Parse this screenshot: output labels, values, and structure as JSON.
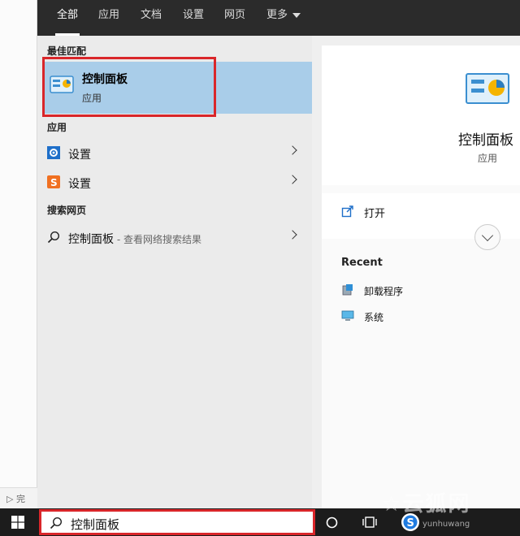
{
  "background_app": {
    "status_text": "完"
  },
  "tabs": [
    {
      "label": "全部",
      "active": true
    },
    {
      "label": "应用"
    },
    {
      "label": "文档"
    },
    {
      "label": "设置"
    },
    {
      "label": "网页"
    },
    {
      "label": "更多"
    }
  ],
  "best_match": {
    "section_title": "最佳匹配",
    "name": "控制面板",
    "type": "应用"
  },
  "apps": {
    "section_title": "应用",
    "items": [
      {
        "label": "设置",
        "icon": "gear-icon"
      },
      {
        "label": "设置",
        "icon": "sogou-icon"
      }
    ]
  },
  "web": {
    "section_title": "搜索网页",
    "query": "控制面板",
    "suffix": " - 查看网络搜索结果"
  },
  "preview": {
    "title": "控制面板",
    "type": "应用",
    "open_label": "打开",
    "recent_title": "Recent",
    "recent_items": [
      {
        "label": "卸载程序"
      },
      {
        "label": "系统"
      }
    ]
  },
  "taskbar": {
    "search_value": "控制面板"
  },
  "watermark": {
    "text": "云狐网",
    "sub": "yunhuwang"
  },
  "colors": {
    "accent_selected": "#a9cde9",
    "highlight_box": "#d9262a",
    "topbar": "#2b2b2b",
    "taskbar": "#1c1c1c"
  }
}
